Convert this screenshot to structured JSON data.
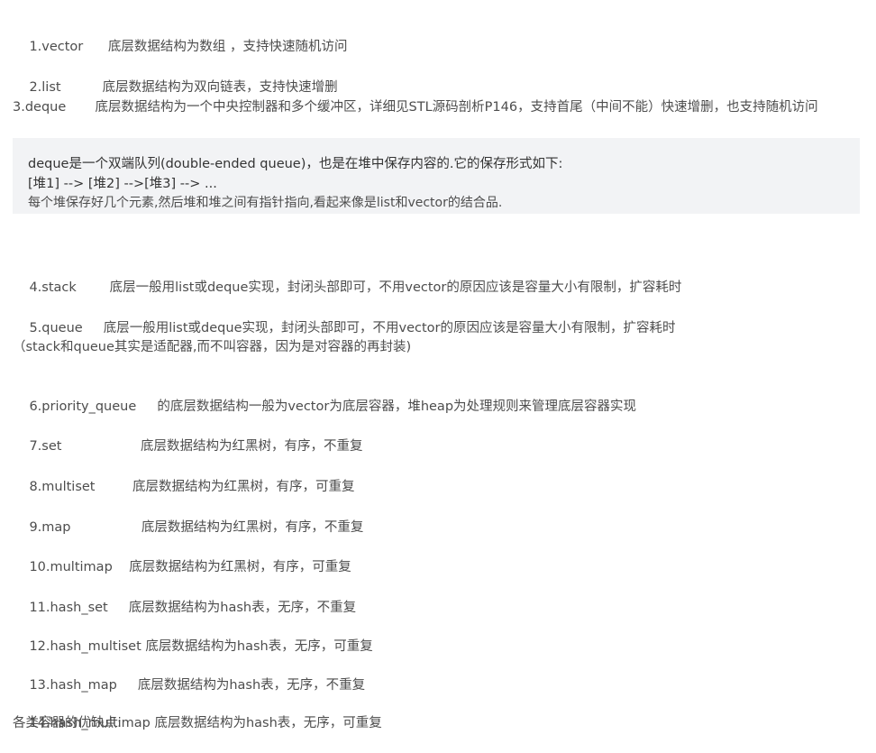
{
  "items": [
    {
      "name": "1.vector",
      "pad": "      ",
      "desc": "底层数据结构为数组 ，支持快速随机访问"
    },
    {
      "name": "2.list",
      "pad": "          ",
      "desc": "底层数据结构为双向链表，支持快速增删"
    },
    {
      "name": "3.deque",
      "pad": "       ",
      "desc": "底层数据结构为一个中央控制器和多个缓冲区，详细见STL源码剖析P146，支持首尾（中间不能）快速增删，也支持随机访问"
    },
    {
      "name": "4.stack",
      "pad": "        ",
      "desc": "底层一般用list或deque实现，封闭头部即可，不用vector的原因应该是容量大小有限制，扩容耗时"
    },
    {
      "name": "5.queue",
      "pad": "     ",
      "desc": "底层一般用list或deque实现，封闭头部即可，不用vector的原因应该是容量大小有限制，扩容耗时"
    },
    {
      "name": "6.priority_queue",
      "pad": "     ",
      "desc": "的底层数据结构一般为vector为底层容器，堆heap为处理规则来管理底层容器实现"
    },
    {
      "name": "7.set",
      "pad": "                   ",
      "desc": "底层数据结构为红黑树，有序，不重复"
    },
    {
      "name": "8.multiset",
      "pad": "         ",
      "desc": "底层数据结构为红黑树，有序，可重复"
    },
    {
      "name": "9.map",
      "pad": "                 ",
      "desc": "底层数据结构为红黑树，有序，不重复"
    },
    {
      "name": "10.multimap",
      "pad": "    ",
      "desc": "底层数据结构为红黑树，有序，可重复"
    },
    {
      "name": "11.hash_set",
      "pad": "     ",
      "desc": "底层数据结构为hash表，无序，不重复"
    },
    {
      "name": "12.hash_multiset",
      "pad": " ",
      "desc": "底层数据结构为hash表，无序，可重复"
    },
    {
      "name": "13.hash_map",
      "pad": "     ",
      "desc": "底层数据结构为hash表，无序，不重复"
    },
    {
      "name": "14.hash_multimap",
      "pad": " ",
      "desc": "底层数据结构为hash表，无序，可重复"
    }
  ],
  "code": {
    "line1": "deque是一个双端队列(double-ended queue)，也是在堆中保存内容的.它的保存形式如下:",
    "line2": "[堆1] --> [堆2] -->[堆3] --> ...",
    "line3": "每个堆保存好几个元素,然后堆和堆之间有指针指向,看起来像是list和vector的结合品."
  },
  "note": "（stack和queue其实是适配器,而不叫容器，因为是对容器的再封装)",
  "footer": "各类容器的优缺点:"
}
